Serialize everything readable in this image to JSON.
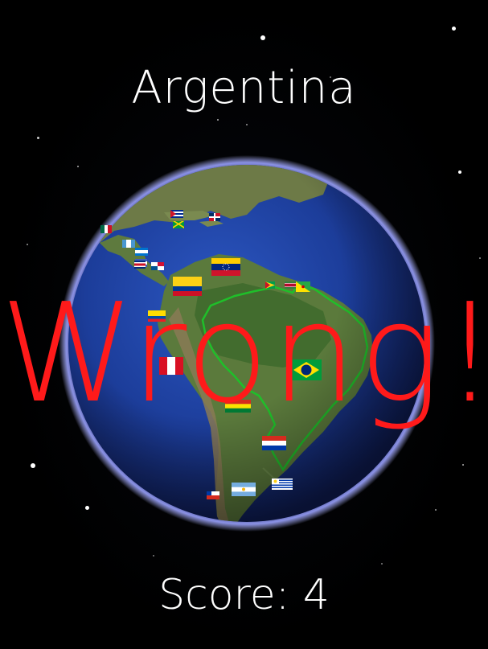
{
  "game": {
    "target_country": "Argentina",
    "feedback": "Wrong!",
    "score_label": "Score:",
    "score_value": "4"
  },
  "colors": {
    "background": "#000000",
    "text": "#ffffff",
    "feedback": "#ff1a1a",
    "ocean": "#1c3d9a",
    "land": "#5c7a3a",
    "border_highlight": "#1fbf2a",
    "atmosphere": "#7f86ff"
  },
  "flags": [
    {
      "country": "Mexico",
      "icon": "flag-mexico-icon"
    },
    {
      "country": "Cuba",
      "icon": "flag-cuba-icon"
    },
    {
      "country": "Jamaica",
      "icon": "flag-jamaica-icon"
    },
    {
      "country": "Dominican Republic",
      "icon": "flag-dominican-republic-icon"
    },
    {
      "country": "Guatemala",
      "icon": "flag-guatemala-icon"
    },
    {
      "country": "Honduras",
      "icon": "flag-honduras-icon"
    },
    {
      "country": "Nicaragua",
      "icon": "flag-nicaragua-icon"
    },
    {
      "country": "Costa Rica",
      "icon": "flag-costa-rica-icon"
    },
    {
      "country": "Panama",
      "icon": "flag-panama-icon"
    },
    {
      "country": "Venezuela",
      "icon": "flag-venezuela-icon"
    },
    {
      "country": "Colombia",
      "icon": "flag-colombia-icon"
    },
    {
      "country": "Ecuador",
      "icon": "flag-ecuador-icon"
    },
    {
      "country": "Guyana",
      "icon": "flag-guyana-icon"
    },
    {
      "country": "Suriname",
      "icon": "flag-suriname-icon"
    },
    {
      "country": "French Guiana",
      "icon": "flag-french-guiana-icon"
    },
    {
      "country": "Peru",
      "icon": "flag-peru-icon"
    },
    {
      "country": "Brazil",
      "icon": "flag-brazil-icon"
    },
    {
      "country": "Bolivia",
      "icon": "flag-bolivia-icon"
    },
    {
      "country": "Paraguay",
      "icon": "flag-paraguay-icon"
    },
    {
      "country": "Chile",
      "icon": "flag-chile-icon"
    },
    {
      "country": "Argentina",
      "icon": "flag-argentina-icon"
    },
    {
      "country": "Uruguay",
      "icon": "flag-uruguay-icon"
    }
  ]
}
